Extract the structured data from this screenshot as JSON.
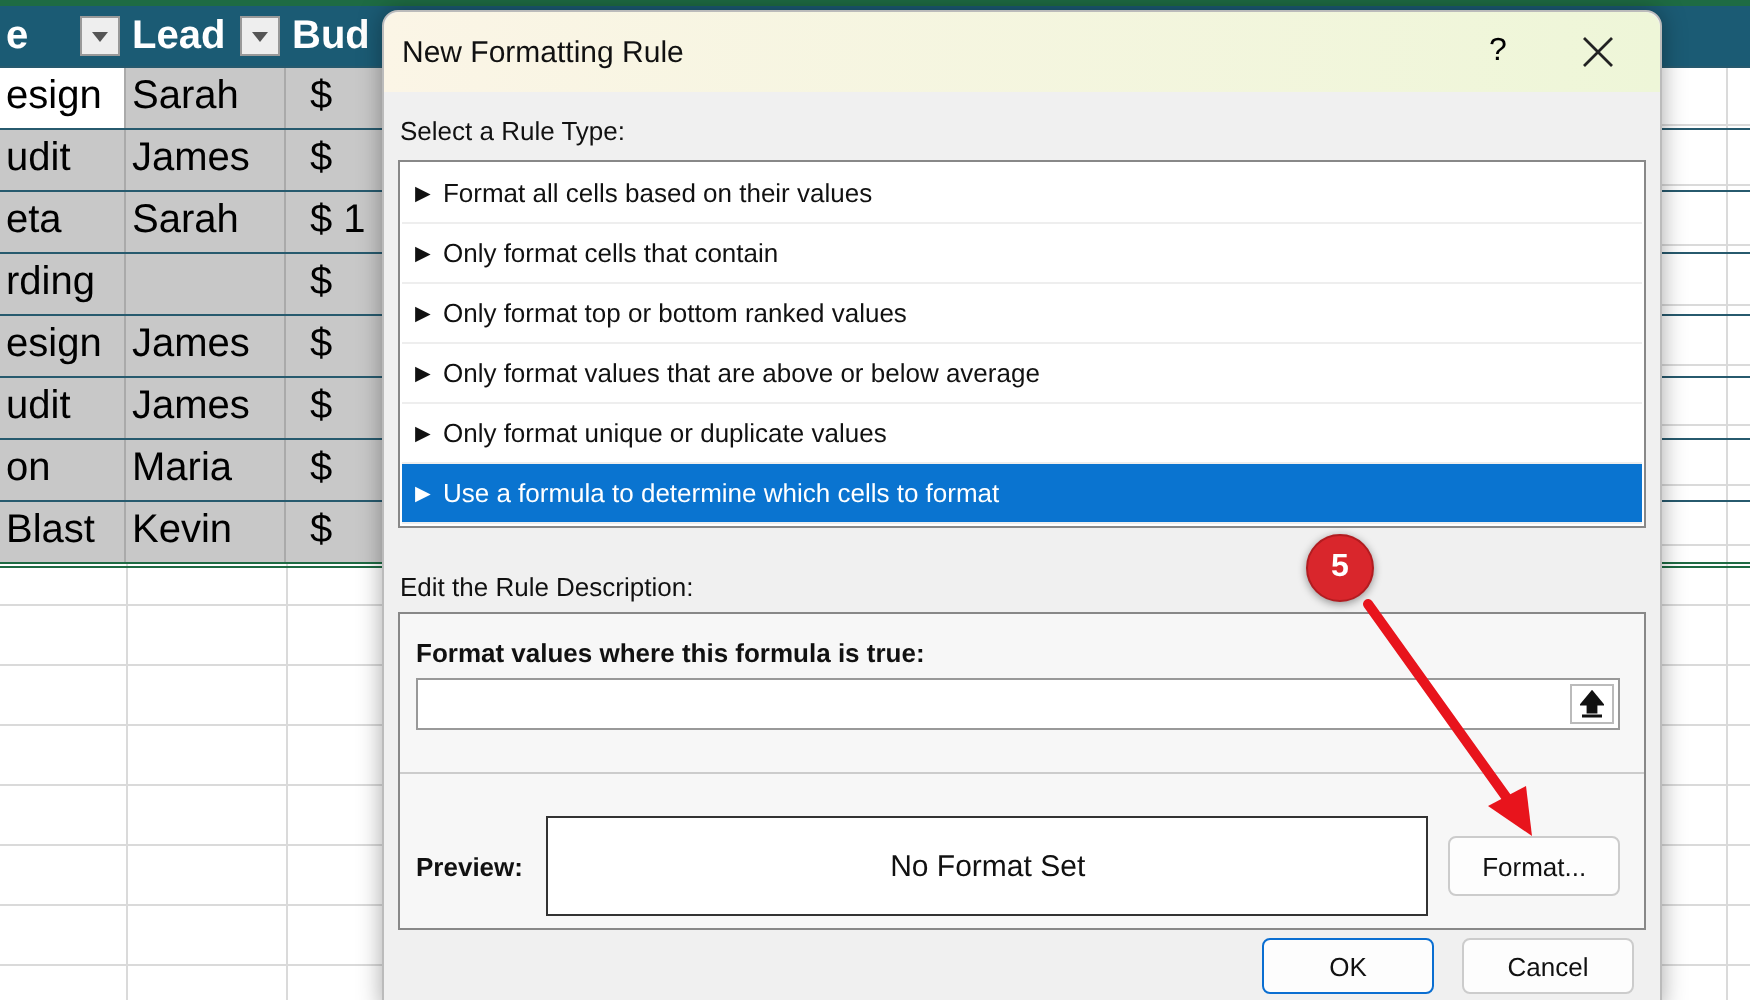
{
  "sheet": {
    "columns": [
      {
        "label": "e",
        "filter": true
      },
      {
        "label": "Lead",
        "filter": true
      },
      {
        "label": "Bud"
      }
    ],
    "rows": [
      {
        "cells": [
          "esign",
          "Sarah",
          "$"
        ],
        "active": true
      },
      {
        "cells": [
          "udit",
          "James",
          "$"
        ],
        "active": false
      },
      {
        "cells": [
          "eta",
          "Sarah",
          "$ 1"
        ],
        "active": false
      },
      {
        "cells": [
          "rding",
          "",
          "$"
        ],
        "active": false
      },
      {
        "cells": [
          "esign",
          "James",
          "$"
        ],
        "active": false
      },
      {
        "cells": [
          "udit",
          "James",
          "$"
        ],
        "active": false
      },
      {
        "cells": [
          "on",
          "Maria",
          "$"
        ],
        "active": false
      },
      {
        "cells": [
          "Blast",
          "Kevin",
          "$"
        ],
        "active": false
      }
    ]
  },
  "dialog": {
    "title": "New Formatting Rule",
    "help": "?",
    "rule_type_label": "Select a Rule Type:",
    "rule_types": [
      {
        "label": "Format all cells based on their values",
        "selected": false
      },
      {
        "label": "Only format cells that contain",
        "selected": false
      },
      {
        "label": "Only format top or bottom ranked values",
        "selected": false
      },
      {
        "label": "Only format values that are above or below average",
        "selected": false
      },
      {
        "label": "Only format unique or duplicate values",
        "selected": false
      },
      {
        "label": "Use a formula to determine which cells to format",
        "selected": true
      }
    ],
    "bullet": "►",
    "description_label": "Edit the Rule Description:",
    "formula_label": "Format values where this formula is true:",
    "preview_label": "Preview:",
    "preview_text": "No Format Set",
    "format_button": "Format...",
    "buttons": [
      {
        "label": "OK",
        "default": true
      },
      {
        "label": "Cancel",
        "default": false
      }
    ]
  },
  "annotation": {
    "badge": "5"
  }
}
